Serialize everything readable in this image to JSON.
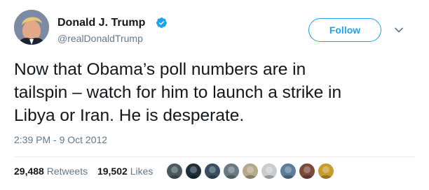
{
  "author": {
    "name": "Donald J. Trump",
    "handle": "@realDonaldTrump",
    "verified": true
  },
  "follow_button": {
    "label": "Follow"
  },
  "menu": {
    "icon": "chevron-down-icon"
  },
  "tweet": {
    "lines": [
      "Now that Obama’s poll numbers are in",
      "tailspin – watch for him to launch a strike in",
      "Libya or Iran.  He is desperate."
    ],
    "timestamp": "2:39 PM - 9 Oct 2012"
  },
  "stats": {
    "retweets_count": "29,488",
    "retweets_label": "Retweets",
    "likes_count": "19,502",
    "likes_label": "Likes"
  },
  "likers": [
    {
      "color": "#4a5a5f"
    },
    {
      "color": "#1f2f3a"
    },
    {
      "color": "#3a4e63"
    },
    {
      "color": "#6b7a80"
    },
    {
      "color": "#b6a98a"
    },
    {
      "color": "#c9ccce"
    },
    {
      "color": "#5b7c9a"
    },
    {
      "color": "#7a4a3a"
    },
    {
      "color": "#c99b2e"
    }
  ],
  "colors": {
    "accent": "#1da1f2",
    "text": "#14171a",
    "secondary_text": "#657786"
  }
}
